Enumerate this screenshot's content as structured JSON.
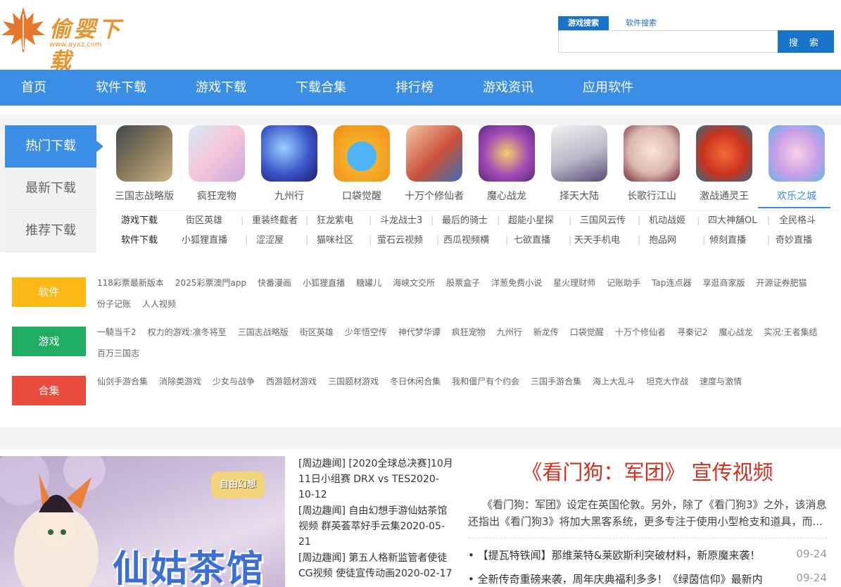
{
  "header": {
    "logo_text": "偷婴下载",
    "logo_url": "www.ayxz.com",
    "search_tabs": [
      "游戏搜索",
      "软件搜索"
    ],
    "search_button": "搜 索",
    "search_value": ""
  },
  "nav": [
    "首页",
    "软件下载",
    "游戏下载",
    "下载合集",
    "排行榜",
    "游戏资讯",
    "应用软件"
  ],
  "hot": {
    "side_tabs": [
      "热门下载",
      "最新下载",
      "推荐下载"
    ],
    "games": [
      "三国志战略版",
      "疯狂宠物",
      "九州行",
      "口袋觉醒",
      "十万个修仙者",
      "魔心战龙",
      "择天大陆",
      "长歌行江山",
      "激战通灵王",
      "欢乐之城"
    ],
    "game_row_label": "游戏下载",
    "game_row": [
      "街区英雄",
      "重装终截者",
      "狂龙紫电",
      "斗龙战士3",
      "最后的骑士",
      "超能小星探",
      "三国风云传",
      "机动战姬",
      "四大神舖OL",
      "全民格斗"
    ],
    "soft_row_label": "软件下载",
    "soft_row": [
      "小狐狸直播",
      "涩涩屋",
      "猫咪社区",
      "萤石云视频",
      "西瓜视频横",
      "七欲直播",
      "天天手机电",
      "抱品网",
      "倾刻直播",
      "奇妙直播"
    ]
  },
  "tags": {
    "software_label": "软件",
    "software": [
      "118彩票最新版本",
      "2025彩票澳門app",
      "快番漫画",
      "小狐狸直播",
      "糖罐儿",
      "海峡文交所",
      "股票盒子",
      "洋葱免费小说",
      "星火理财师",
      "记账助手",
      "Tap连点器",
      "享逛商家版",
      "开源证券肥猫",
      "份子记账",
      "人人视频"
    ],
    "games_label": "游戏",
    "games": [
      "一騎当千2",
      "权力的游戏:凛冬将至",
      "三国志战略版",
      "街区英雄",
      "少年悟空传",
      "神代梦华谭",
      "疯狂宠物",
      "九州行",
      "新龙传",
      "口袋觉醒",
      "十万个修仙者",
      "寻秦记2",
      "魔心战龙",
      "实况:王者集结",
      "百万三国志"
    ],
    "collection_label": "合集",
    "collections": [
      "仙剑手游合集",
      "消除类游戏",
      "少女与战争",
      "西游题材游戏",
      "三国题材游戏",
      "冬日休闲合集",
      "我和僵尸有个约会",
      "三国手游合集",
      "海上大乱斗",
      "坦克大作战",
      "速度与激情"
    ]
  },
  "bottom": {
    "banner_text": "仙姑茶馆",
    "banner_logo": "自由幻想",
    "news": [
      "[周边趣闻] [2020全球总决赛]10月11日小组赛 DRX vs TES2020-10-12",
      "[周边趣闻] 自由幻想手游仙姑茶馆视频 群英荟萃好手云集2020-05-21",
      "[周边趣闻] 第五人格新监管者使徒CG视频 使徒宣传动画2020-02-17"
    ],
    "video_title": "《看门狗：军团》 宣传视频",
    "video_desc": "《看门狗：军团》设定在英国伦敦。另外，除了《看门狗3》之外，该消息还指出《看门狗3》将加大黑客系统，更多专注于使用小型枪支和道具，而...",
    "articles": [
      {
        "title": "【提瓦特铁闻】那维莱特&莱欧斯利突破材料，新原魔来袭！",
        "date": "09-24"
      },
      {
        "title": "全新传奇重磅来袭，周年庆典福利多多！《绿茵信仰》最新内",
        "date": "09-24"
      }
    ]
  },
  "colors": {
    "nav": "#3a8ee6",
    "software": "#fcb814",
    "games": "#1fad63",
    "collections": "#e94b3c",
    "video_title": "#d42e1f"
  }
}
